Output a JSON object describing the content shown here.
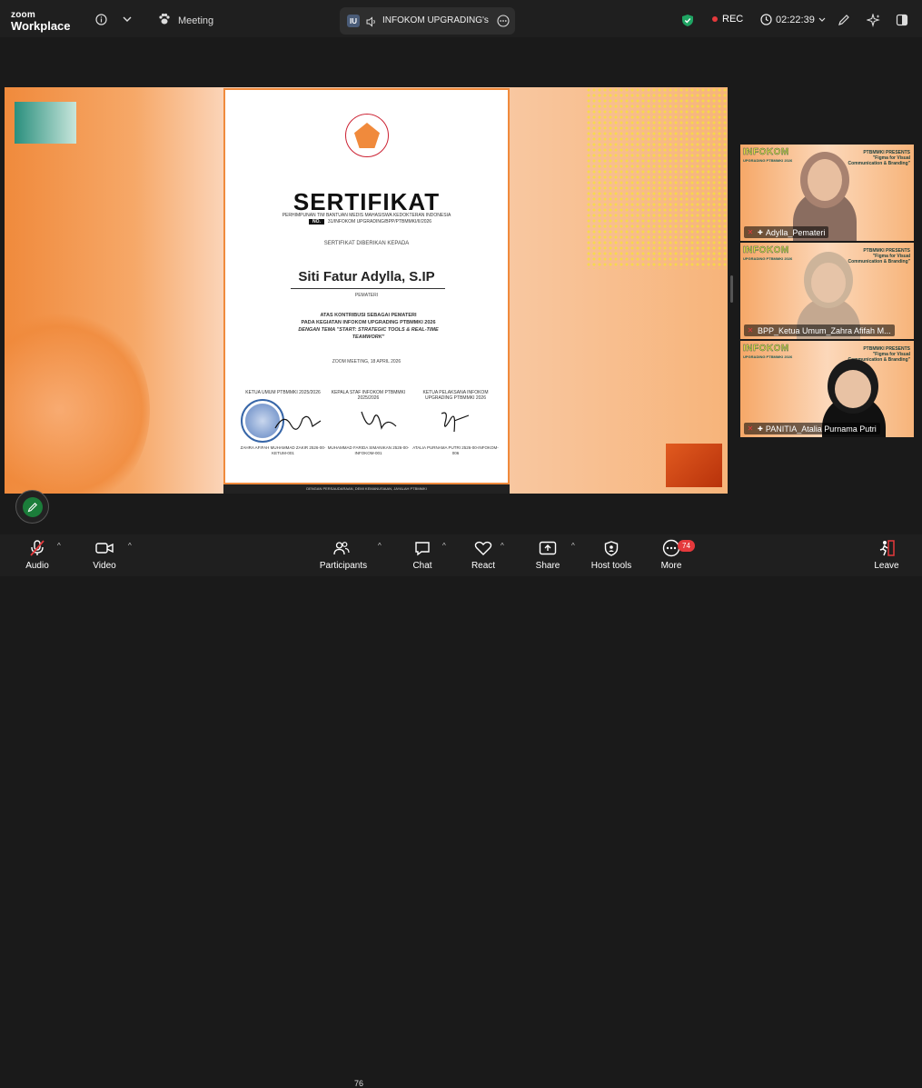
{
  "app": {
    "logo_line1": "zoom",
    "logo_line2": "Workplace"
  },
  "topbar": {
    "meeting_label": "Meeting",
    "share_badge": "IU",
    "share_title": "INFOKOM UPGRADING's scr",
    "rec_label": "REC",
    "timer": "02:22:39",
    "shield_color": "#1fa463"
  },
  "certificate": {
    "title": "SERTIFIKAT",
    "subtitle": "PERHIMPUNAN TIM BANTUAN MEDIS MAHASISWA KEDOKTERAN INDONESIA",
    "no_label": "NO.",
    "no_value": "31/INFOKOM UPGRADING/BPP/PTBMMKI/II/2026",
    "given_to": "SERTIFIKAT DIBERIKAN KEPADA",
    "recipient": "Siti Fatur Adylla, S.IP",
    "role": "PEMATERI",
    "body_line1": "ATAS KONTRIBUSI SEBAGAI PEMATERI",
    "body_line2": "PADA KEGIATAN INFOKOM UPGRADING PTBMMKI 2026",
    "body_line3": "DENGAN TEMA \"START: STRATEGIC TOOLS & REAL-TIME TEAMWORK\"",
    "date": "ZOOM MEETING, 18 APRIL 2026",
    "signatories": [
      {
        "title": "KETUA UMUM PTBMMKI 2025/2026",
        "name": "ZAHRA AFIFAH MUHAMMAD ZAKIR 2526-00-KETUM-001"
      },
      {
        "title": "KEPALA STAF INFOKOM PTBMMKI 2025/2026",
        "name": "MUHAMMAD FARIDA SIMANIKAN 2526-00-INFOKOM-001"
      },
      {
        "title": "KETUA PELAKSANA INFOKOM UPGRADING PTBMMKI 2026",
        "name": "ATALIA PURNAMA PUTRI 2526-00-INFOKOM-006"
      }
    ],
    "footer": "DENGAN PERSAUDARAAN, DEMI KEMANUSIAAN, JAYALAH PTBMMKI"
  },
  "gallery": {
    "brand": "INFOKOM",
    "brand_sub": "UPGRADING PTBMMKI 2026",
    "tile_caption": "PTBMMKI PRESENTS \"Figma for Visual Communication & Branding\"",
    "participants": [
      {
        "name": "Adylla_Pemateri"
      },
      {
        "name": "BPP_Ketua Umum_Zahra Afifah M..."
      },
      {
        "name": "PANITIA_Atalia Purnama Putri"
      }
    ]
  },
  "toolbar": {
    "audio": "Audio",
    "video": "Video",
    "participants": "Participants",
    "participants_count": "76",
    "chat": "Chat",
    "react": "React",
    "share": "Share",
    "host_tools": "Host tools",
    "more": "More",
    "more_badge": "74",
    "leave": "Leave"
  }
}
